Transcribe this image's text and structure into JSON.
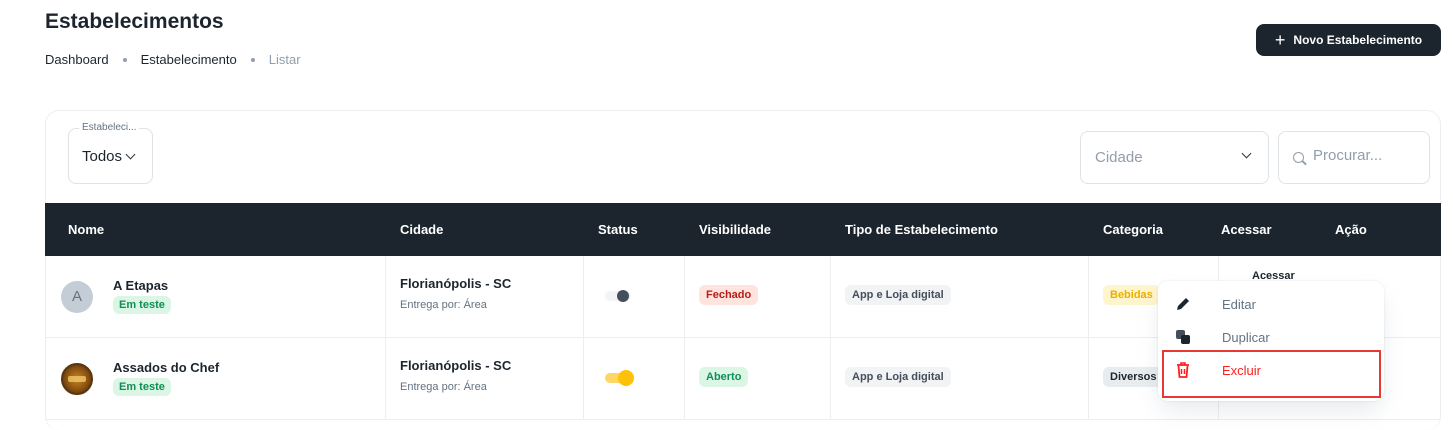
{
  "header": {
    "title": "Estabelecimentos",
    "breadcrumb": [
      "Dashboard",
      "Estabelecimento",
      "Listar"
    ],
    "new_button_label": "Novo Estabelecimento"
  },
  "filters": {
    "type_label": "Estabeleci...",
    "type_value": "Todos",
    "city_placeholder": "Cidade",
    "search_placeholder": "Procurar..."
  },
  "table": {
    "columns": [
      "Nome",
      "Cidade",
      "Status",
      "Visibilidade",
      "Tipo de Estabelecimento",
      "Categoria",
      "Acessar",
      "Ação"
    ],
    "rows": [
      {
        "avatar_letter": "A",
        "name": "A Etapas",
        "tag": "Em teste",
        "city": "Florianópolis - SC",
        "delivery": "Entrega por: Área",
        "status_on": false,
        "visibility": "Fechado",
        "type": "App e Loja digital",
        "category": "Bebidas",
        "access": "Acessar"
      },
      {
        "avatar_letter": "",
        "name": "Assados do Chef",
        "tag": "Em teste",
        "city": "Florianópolis - SC",
        "delivery": "Entrega por: Área",
        "status_on": true,
        "visibility": "Aberto",
        "type": "App e Loja digital",
        "category": "Diversos",
        "access": ""
      }
    ]
  },
  "context_menu": {
    "items": [
      {
        "label": "Editar",
        "icon": "pencil-icon"
      },
      {
        "label": "Duplicar",
        "icon": "copy-icon"
      },
      {
        "label": "Excluir",
        "icon": "trash-icon"
      }
    ]
  },
  "colors": {
    "header_bg": "#1c252e",
    "danger": "#ff1f1f",
    "highlight": "#e53935",
    "toggle_on": "#ffc107"
  }
}
